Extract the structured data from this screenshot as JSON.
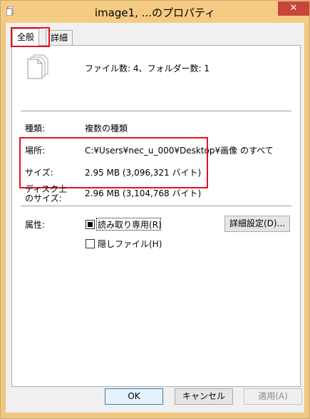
{
  "window": {
    "title": "image1, ...のプロパティ",
    "close_label": "✕"
  },
  "tabs": [
    {
      "label": "全般",
      "selected": true
    },
    {
      "label": "詳細",
      "selected": false
    }
  ],
  "general": {
    "file_count": "ファイル数: 4、フォルダー数: 1",
    "type_label": "種類:",
    "type_value": "複数の種類",
    "location_label": "場所:",
    "location_value": "C:¥Users¥nec_u_000¥Desktop¥画像 のすべて",
    "size_label": "サイズ:",
    "size_value": "2.95 MB (3,096,321 バイト)",
    "disk_size_label_line1": "ディスク上",
    "disk_size_label_line2": "のサイズ:",
    "disk_size_value": "2.96 MB (3,104,768 バイト)",
    "attributes_label": "属性:",
    "readonly_label": "読み取り専用(R)",
    "readonly_checked": "indeterminate",
    "hidden_label": "隠しファイル(H)",
    "hidden_checked": false,
    "advanced_button": "詳細設定(D)..."
  },
  "footer": {
    "ok_label": "OK",
    "cancel_label": "キャンセル",
    "apply_label": "適用(A)"
  },
  "colors": {
    "title_bar": "#f5cb84",
    "close_button": "#c7453a",
    "highlight": "#e0131f"
  }
}
